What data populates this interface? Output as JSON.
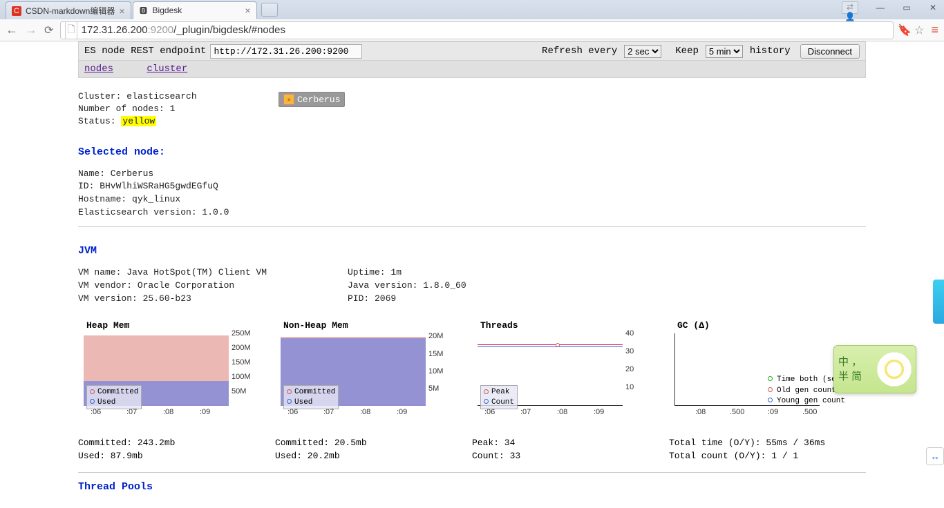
{
  "browser": {
    "tabs": [
      {
        "title": "CSDN-markdown编辑器",
        "active": false
      },
      {
        "title": "Bigdesk",
        "active": true
      }
    ],
    "url": {
      "host": "172.31.26.200",
      "port": ":9200",
      "path": "/_plugin/bigdesk/#nodes"
    },
    "window_controls": {
      "min": "—",
      "max": "▭",
      "close": "✕"
    }
  },
  "toolbar": {
    "endpoint_label": "ES node REST endpoint",
    "endpoint_value": "http://172.31.26.200:9200",
    "refresh_label": "Refresh every",
    "refresh_options": [
      "2 sec"
    ],
    "refresh_selected": "2 sec",
    "keep_label": "Keep",
    "keep_options": [
      "5 min"
    ],
    "keep_selected": "5 min",
    "history_label": "history",
    "disconnect_label": "Disconnect"
  },
  "subnav": {
    "nodes": "nodes",
    "cluster": "cluster"
  },
  "cluster": {
    "name_line": "Cluster: elasticsearch",
    "nodes_line": "Number of nodes: 1",
    "status_prefix": "Status: ",
    "status_value": "yellow",
    "node_chip": "Cerberus"
  },
  "selected_node": {
    "heading": "Selected node:",
    "name": "Name: Cerberus",
    "id": "ID: BHvWlhiWSRaHG5gwdEGfuQ",
    "hostname": "Hostname: qyk_linux",
    "es_version": "Elasticsearch version: 1.0.0"
  },
  "jvm": {
    "heading": "JVM",
    "left": {
      "vm_name": "VM name: Java HotSpot(TM) Client VM",
      "vm_vendor": "VM vendor: Oracle Corporation",
      "vm_version": "VM version: 25.60-b23"
    },
    "right": {
      "uptime": "Uptime: 1m",
      "java_version": "Java version: 1.8.0_60",
      "pid": "PID: 2069"
    }
  },
  "charts": {
    "x_ticks": [
      ":06",
      ":07",
      ":08",
      ":09"
    ],
    "heap": {
      "title": "Heap Mem",
      "y_ticks": [
        "250M",
        "200M",
        "150M",
        "100M",
        "50M"
      ],
      "legend": {
        "a": "Committed",
        "b": "Used"
      },
      "stats": {
        "committed": "Committed: 243.2mb",
        "used": "Used: 87.9mb"
      }
    },
    "nonheap": {
      "title": "Non-Heap Mem",
      "y_ticks": [
        "20M",
        "15M",
        "10M",
        "5M"
      ],
      "legend": {
        "a": "Committed",
        "b": "Used"
      },
      "stats": {
        "committed": "Committed: 20.5mb",
        "used": "Used: 20.2mb"
      }
    },
    "threads": {
      "title": "Threads",
      "y_ticks": [
        "40",
        "30",
        "20",
        "10"
      ],
      "legend": {
        "a": "Peak",
        "b": "Count"
      },
      "stats": {
        "peak": "Peak: 34",
        "count": "Count: 33"
      }
    },
    "gc": {
      "title": "GC (Δ)",
      "x_ticks": [
        ":08",
        ".500",
        ":09",
        ".500"
      ],
      "legend": {
        "a": "Time both (sec)",
        "b": "Old gen count",
        "c": "Young gen count"
      },
      "stats": {
        "time": "Total time (O/Y): 55ms / 36ms",
        "count": "Total count (O/Y): 1 / 1"
      }
    }
  },
  "threadpools": {
    "heading": "Thread Pools"
  },
  "ime": {
    "line1": "中 ，",
    "line2": "半 简"
  },
  "chart_data": [
    {
      "type": "area",
      "title": "Heap Mem",
      "x": [
        ":06",
        ":07",
        ":08",
        ":09"
      ],
      "series": [
        {
          "name": "Committed",
          "values": [
            243.2,
            243.2,
            243.2,
            243.2
          ],
          "unit": "MB"
        },
        {
          "name": "Used",
          "values": [
            87.9,
            87.9,
            87.9,
            87.9
          ],
          "unit": "MB"
        }
      ],
      "ylim": [
        0,
        250
      ],
      "ylabel": "MB"
    },
    {
      "type": "area",
      "title": "Non-Heap Mem",
      "x": [
        ":06",
        ":07",
        ":08",
        ":09"
      ],
      "series": [
        {
          "name": "Committed",
          "values": [
            20.5,
            20.5,
            20.5,
            20.5
          ],
          "unit": "MB"
        },
        {
          "name": "Used",
          "values": [
            20.2,
            20.2,
            20.2,
            20.2
          ],
          "unit": "MB"
        }
      ],
      "ylim": [
        0,
        22
      ],
      "ylabel": "MB"
    },
    {
      "type": "line",
      "title": "Threads",
      "x": [
        ":06",
        ":07",
        ":08",
        ":09"
      ],
      "series": [
        {
          "name": "Peak",
          "values": [
            34,
            34,
            34,
            34
          ]
        },
        {
          "name": "Count",
          "values": [
            33,
            33,
            33,
            33
          ]
        }
      ],
      "ylim": [
        0,
        40
      ]
    },
    {
      "type": "line",
      "title": "GC (Δ)",
      "x": [
        ":08",
        ".500",
        ":09",
        ".500"
      ],
      "series": [
        {
          "name": "Time both (sec)",
          "values": []
        },
        {
          "name": "Old gen count",
          "values": []
        },
        {
          "name": "Young gen count",
          "values": []
        }
      ],
      "ylim": [
        0,
        1
      ]
    }
  ]
}
